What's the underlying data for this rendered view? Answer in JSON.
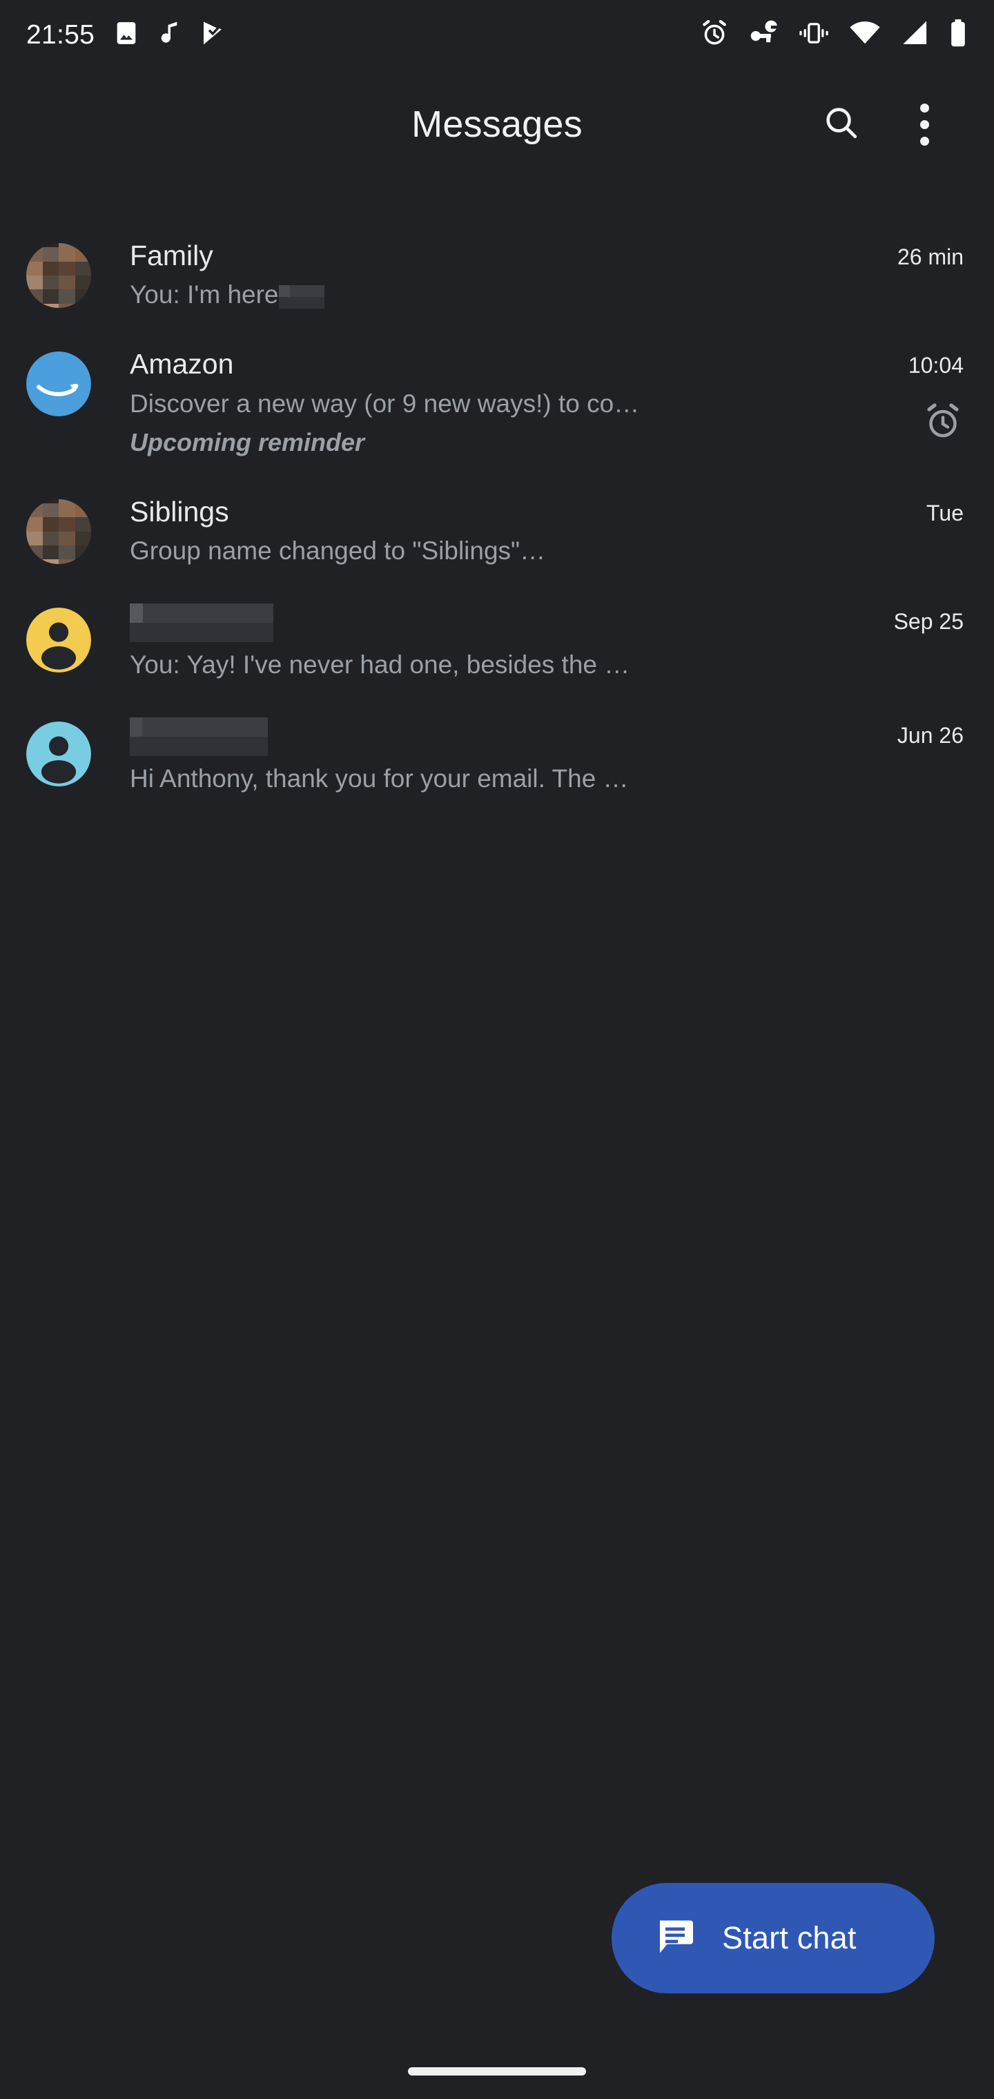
{
  "status_bar": {
    "time": "21:55",
    "left_icons": [
      "photo-icon",
      "music-note-icon",
      "play-check-icon"
    ],
    "right_icons": [
      "alarm-icon",
      "vpn-key-icon",
      "vibrate-icon",
      "wifi-icon",
      "cellular-signal-icon",
      "battery-icon"
    ]
  },
  "app_bar": {
    "title": "Messages",
    "search_icon": "search-icon",
    "overflow_icon": "more-vert-icon"
  },
  "conversations": [
    {
      "name": "Family",
      "name_redacted": false,
      "snippet": "You: I'm here",
      "snippet_redacted_suffix": true,
      "sub": "",
      "time": "26 min",
      "avatar_type": "photo-mosaic",
      "avatar_color": "#7a5a48",
      "reminder_icon": false
    },
    {
      "name": "Amazon",
      "name_redacted": false,
      "snippet": "Discover a new way (or 9 new ways!) to co…",
      "snippet_redacted_suffix": false,
      "sub": "Upcoming reminder",
      "time": "10:04",
      "avatar_type": "amazon-logo",
      "avatar_color": "#4a9fdc",
      "reminder_icon": true
    },
    {
      "name": "Siblings",
      "name_redacted": false,
      "snippet": "Group name changed to \"Siblings\"…",
      "snippet_redacted_suffix": false,
      "sub": "",
      "time": "Tue",
      "avatar_type": "photo-mosaic",
      "avatar_color": "#8a6048",
      "reminder_icon": false
    },
    {
      "name": "",
      "name_redacted": true,
      "snippet": "You: Yay! I've never had one, besides the …",
      "snippet_redacted_suffix": false,
      "sub": "",
      "time": "Sep 25",
      "avatar_type": "person-silhouette",
      "avatar_color": "#f2cb4f",
      "reminder_icon": false
    },
    {
      "name": "",
      "name_redacted": true,
      "snippet": "Hi Anthony, thank you for your email. The …",
      "snippet_redacted_suffix": false,
      "sub": "",
      "time": "Jun 26",
      "avatar_type": "person-silhouette",
      "avatar_color": "#79cde2",
      "reminder_icon": false
    }
  ],
  "fab": {
    "label": "Start chat",
    "icon": "chat-bubble-icon",
    "color": "#2f58b4"
  },
  "theme": {
    "background": "#1f2125",
    "primary_text": "#e8eaed",
    "secondary_text": "#9aa0a6",
    "accent": "#2f58b4"
  },
  "nav_bar": {
    "gesture_pill": "home-gesture-pill"
  }
}
